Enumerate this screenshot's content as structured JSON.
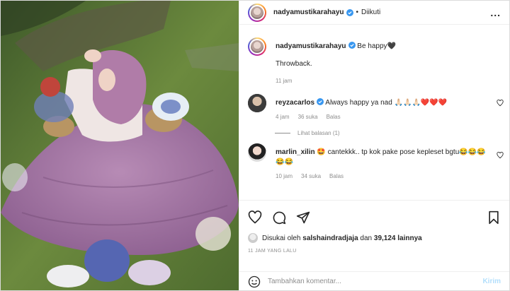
{
  "header": {
    "username": "nadyamustikarahayu",
    "separator": "•",
    "follow_status": "Diikuti",
    "more": "..."
  },
  "caption": {
    "username": "nadyamustikarahayu",
    "text": "Be happy🖤",
    "line2": "Throwback.",
    "time": "11 jam"
  },
  "comments": [
    {
      "username": "reyzacarlos",
      "text": "Always happy ya nad 🙏🏻🙏🏻🙏🏻❤️❤️❤️",
      "time": "4 jam",
      "likes": "36 suka",
      "reply": "Balas",
      "view_replies": "Lihat balasan (1)"
    },
    {
      "username": "marlin_xilin",
      "text": "🤩 cantekkk.. tp kok pake pose kepleset bgtu😂😂😂😂😂",
      "time": "10 jam",
      "likes": "34 suka",
      "reply": "Balas"
    }
  ],
  "likes": {
    "prefix": "Disukai oleh",
    "user": "salshaindradjaja",
    "and": "dan",
    "count": "39,124 lainnya"
  },
  "time_ago": "11 JAM YANG LALU",
  "add_comment": {
    "placeholder": "Tambahkan komentar...",
    "submit": "Kirim"
  },
  "colors": {
    "verified": "#3897f0",
    "submit": "#b2dffc",
    "heart": "#ed4956"
  }
}
